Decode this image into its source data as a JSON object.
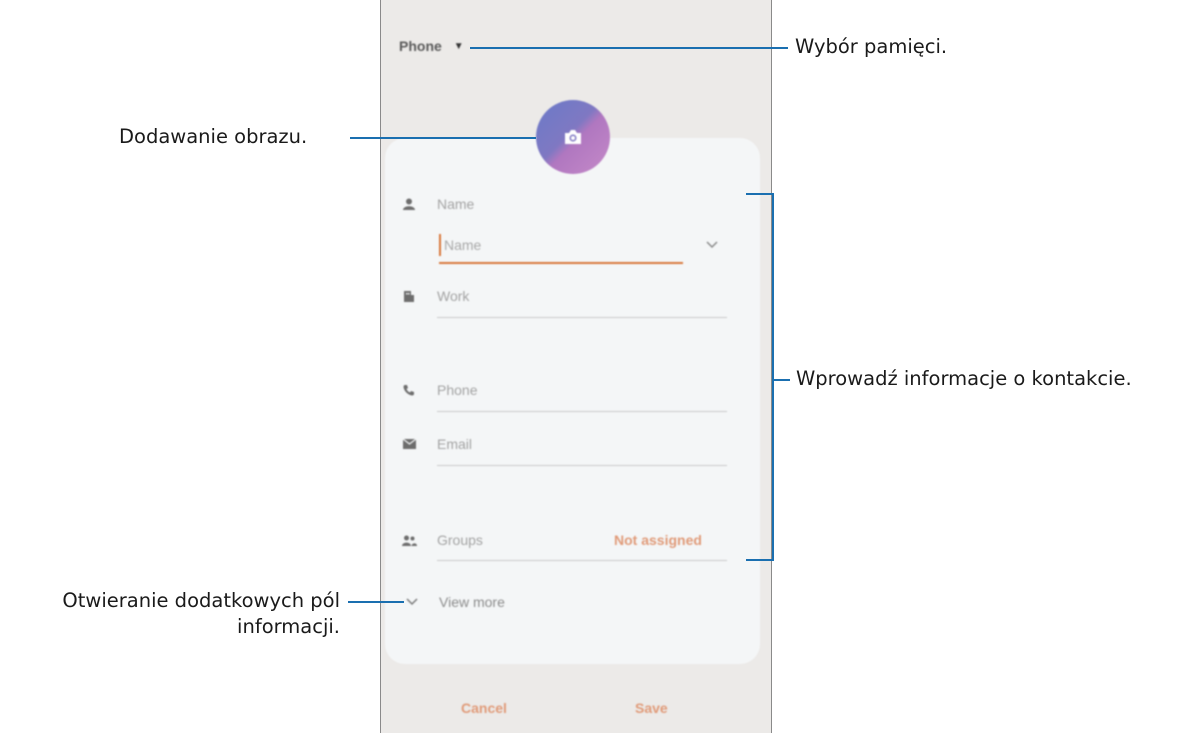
{
  "phone": {
    "storage_selector": "Phone",
    "fields": {
      "name_section_label": "Name",
      "name_input_placeholder": "Name",
      "work_label": "Work",
      "phone_label": "Phone",
      "email_label": "Email",
      "groups_label": "Groups",
      "groups_value": "Not assigned",
      "view_more_label": "View more"
    },
    "footer": {
      "cancel_label": "Cancel",
      "save_label": "Save"
    },
    "colors": {
      "accent": "#d8783c",
      "button_text": "#e09a78",
      "callout_line": "#1a6fb0"
    }
  },
  "callouts": {
    "storage": "Wybór pamięci.",
    "image": "Dodawanie obrazu.",
    "contact_info": "Wprowadź informacje o kontakcie.",
    "more_fields_line1": "Otwieranie dodatkowych pól",
    "more_fields_line2": "informacji."
  },
  "icons": [
    "caret-down-icon",
    "camera-icon",
    "person-icon",
    "chevron-down-icon",
    "building-icon",
    "phone-icon",
    "email-icon",
    "group-icon"
  ]
}
